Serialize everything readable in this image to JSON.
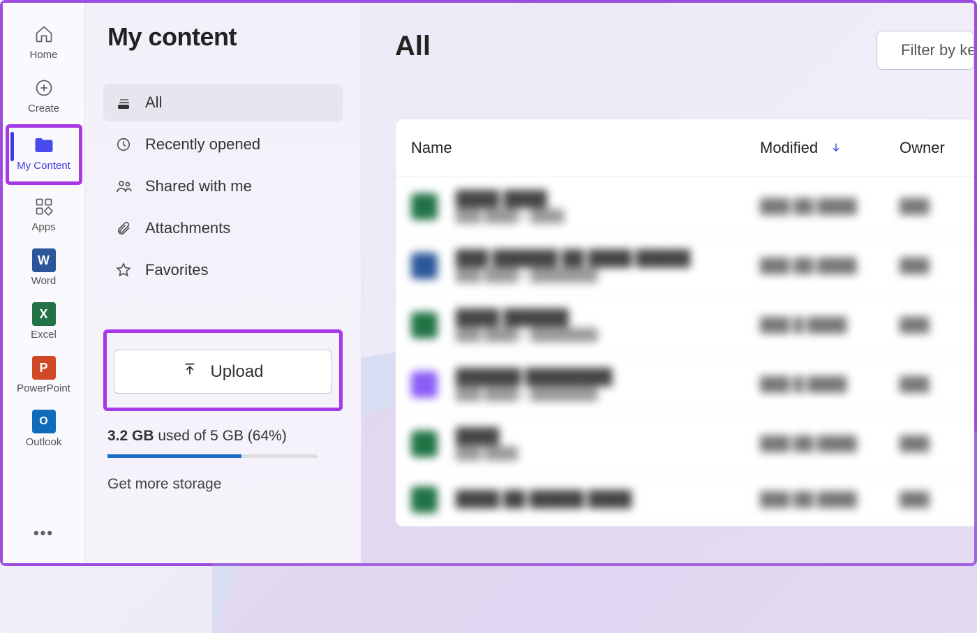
{
  "rail": {
    "items": [
      {
        "label": "Home"
      },
      {
        "label": "Create"
      },
      {
        "label": "My Content"
      },
      {
        "label": "Apps"
      },
      {
        "label": "Word"
      },
      {
        "label": "Excel"
      },
      {
        "label": "PowerPoint"
      },
      {
        "label": "Outlook"
      }
    ],
    "more": "•••"
  },
  "panel": {
    "title": "My content",
    "filters": [
      {
        "label": "All"
      },
      {
        "label": "Recently opened"
      },
      {
        "label": "Shared with me"
      },
      {
        "label": "Attachments"
      },
      {
        "label": "Favorites"
      }
    ],
    "upload_label": "Upload",
    "storage": {
      "used": "3.2 GB",
      "text": "used of 5 GB (64%)",
      "percent": 64,
      "get_more": "Get more storage"
    }
  },
  "main": {
    "title": "All",
    "filter_button": "Filter by ke",
    "columns": {
      "name": "Name",
      "modified": "Modified",
      "owner": "Owner"
    },
    "rows": [
      {
        "color": "#217346"
      },
      {
        "color": "#2b579a"
      },
      {
        "color": "#217346"
      },
      {
        "color": "#8b5cf6"
      },
      {
        "color": "#217346"
      },
      {
        "color": "#217346"
      }
    ]
  }
}
